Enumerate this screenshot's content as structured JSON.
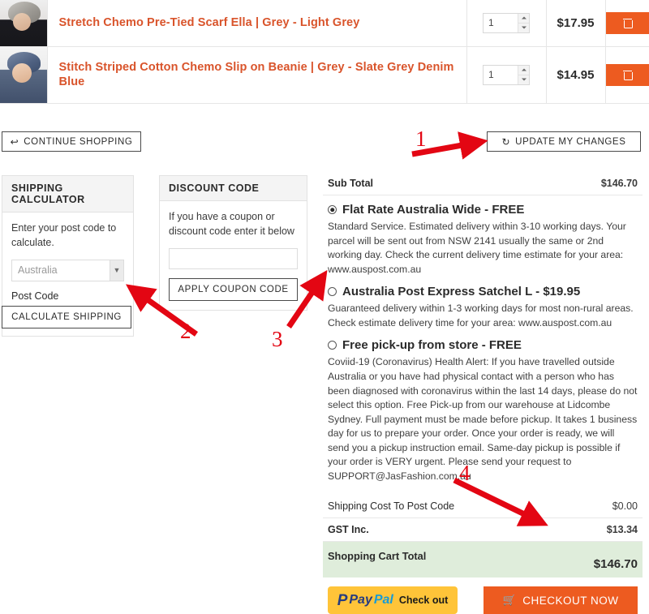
{
  "cart": {
    "items": [
      {
        "thumb": "product-photo-grey-scarf",
        "title": "Stretch Chemo Pre-Tied Scarf Ella | Grey - Light Grey",
        "qty": "1",
        "price": "$17.95",
        "remove_icon": "trash-icon"
      },
      {
        "thumb": "product-photo-blue-beanie",
        "title": "Stitch Striped Cotton Chemo Slip on Beanie | Grey - Slate Grey Denim Blue",
        "qty": "1",
        "price": "$14.95",
        "remove_icon": "trash-icon"
      }
    ]
  },
  "actions": {
    "continue_shopping": "CONTINUE SHOPPING",
    "continue_icon": "back-arrow-icon",
    "update_changes": "UPDATE MY CHANGES",
    "update_icon": "refresh-icon"
  },
  "shipping_calculator": {
    "heading": "SHIPPING CALCULATOR",
    "note": "Enter your post code to calculate.",
    "country_value": "Australia",
    "country_options": [
      "Australia"
    ],
    "postcode_label": "Post Code",
    "postcode_value": "",
    "postcode_placeholder": "",
    "button": "CALCULATE SHIPPING"
  },
  "discount_code": {
    "heading": "DISCOUNT CODE",
    "note": "If you have a coupon or discount code enter it below",
    "input_value": "",
    "input_placeholder": "",
    "button": "APPLY COUPON CODE"
  },
  "summary": {
    "subtotal_label": "Sub Total",
    "subtotal_value": "$146.70",
    "shipping_options": [
      {
        "selected": true,
        "label": "Flat Rate Australia Wide - FREE",
        "description": "Standard Service. Estimated delivery within 3-10 working days. Your parcel will be sent out from NSW 2141 usually the same or 2nd working day. Check the current delivery time estimate for your area: www.auspost.com.au"
      },
      {
        "selected": false,
        "label": "Australia Post Express Satchel L - $19.95",
        "description": "Guaranteed delivery within 1-3 working days for most non-rural areas. Check estimate delivery time for your area: www.auspost.com.au"
      },
      {
        "selected": false,
        "label": "Free pick-up from store - FREE",
        "description": "Coviid-19 (Coronavirus) Health Alert: If you have travelled outside Australia or you have had physical contact with a person who has been diagnosed with coronavirus within the last 14 days, please do not select this option. Free Pick-up from our warehouse at Lidcombe Sydney. Full payment must be made before pickup. It takes 1 business day for us to prepare your order. Once your order is ready, we will send you a pickup instruction email. Same-day pickup is possible if your order is VERY urgent. Please send your request to SUPPORT@JasFashion.com.au"
      }
    ],
    "shipping_cost_label": "Shipping Cost To Post Code",
    "shipping_cost_value": "$0.00",
    "gst_label": "GST Inc.",
    "gst_value": "$13.34",
    "total_label": "Shopping Cart Total",
    "total_value": "$146.70"
  },
  "payment": {
    "paypal_mark": "P",
    "paypal_word1": "Pay",
    "paypal_word2": "Pal",
    "paypal_checkout": "Check out",
    "checkout_label": "CHECKOUT NOW",
    "checkout_icon": "shopping-cart-icon"
  },
  "annotations": {
    "color": "#e30613",
    "steps": [
      {
        "number": "1",
        "target": "update-my-changes-button"
      },
      {
        "number": "2",
        "target": "calculate-shipping-button"
      },
      {
        "number": "3",
        "target": "australia-post-express-radio"
      },
      {
        "number": "4",
        "target": "checkout-now-button"
      }
    ]
  }
}
